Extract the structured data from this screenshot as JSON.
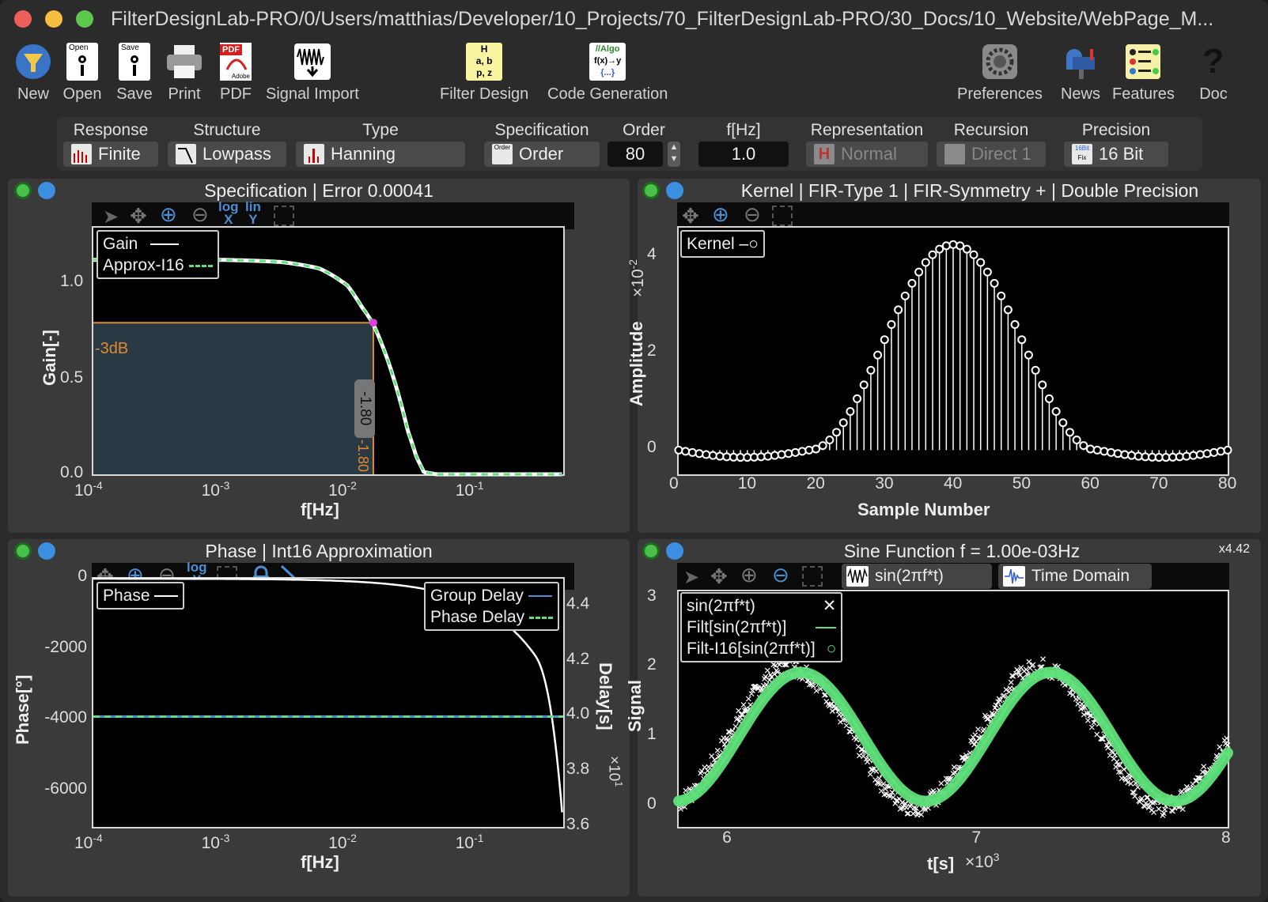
{
  "window": {
    "title": "FilterDesignLab-PRO/0/Users/matthias/Developer/10_Projects/70_FilterDesignLab-PRO/30_Docs/10_Website/WebPage_M..."
  },
  "toolbar": {
    "new": "New",
    "open": "Open",
    "save": "Save",
    "print": "Print",
    "pdf": "PDF",
    "signal_import": "Signal Import",
    "filter_design": "Filter Design",
    "code_generation": "Code Generation",
    "preferences": "Preferences",
    "news": "News",
    "features": "Features",
    "doc": "Doc",
    "icon_text": {
      "open": "Open",
      "save": "Save",
      "pdf": "PDF",
      "adobe": "Adobe",
      "fd1": "H",
      "fd2": "a, b",
      "fd3": "p, z",
      "cg1": "//Algo",
      "cg2": "f(x)→y",
      "cg3": "{...}",
      "doc": "?"
    }
  },
  "options": {
    "response": {
      "header": "Response",
      "value": "Finite"
    },
    "structure": {
      "header": "Structure",
      "value": "Lowpass"
    },
    "type": {
      "header": "Type",
      "value": "Hanning"
    },
    "specification": {
      "header": "Specification",
      "value": "Order",
      "icon": "Order"
    },
    "order": {
      "header": "Order",
      "value": "80"
    },
    "fhz": {
      "header": "f[Hz]",
      "value": "1.0"
    },
    "representation": {
      "header": "Representation",
      "value": "Normal",
      "icon": "H"
    },
    "recursion": {
      "header": "Recursion",
      "value": "Direct 1"
    },
    "precision": {
      "header": "Precision",
      "value": "16 Bit",
      "icon1": "16Bit",
      "icon2": "Fix"
    }
  },
  "panels": {
    "spec": {
      "title": "Specification | Error 0.00041",
      "xlabel": "f[Hz]",
      "ylabel": "Gain[-]",
      "yticks": [
        "1.0",
        "0.5",
        "0.0"
      ],
      "xticks": [
        "10",
        "-4",
        "10",
        "-3",
        "10",
        "-2",
        "10",
        "-1"
      ],
      "legend": [
        "Gain",
        "Approx-I16"
      ],
      "marker_db": "-3dB",
      "marker_val": "-1.80",
      "marker_val2": "-1.80",
      "tool_log": "log",
      "tool_lin": "lin",
      "tool_x": "X",
      "tool_y": "Y"
    },
    "kernel": {
      "title": "Kernel | FIR-Type 1 | FIR-Symmetry + | Double Precision",
      "xlabel": "Sample Number",
      "ylabel": "Amplitude",
      "yscale": "×10",
      "yscale_exp": "-2",
      "yticks": [
        "4",
        "2",
        "0"
      ],
      "xticks": [
        "0",
        "10",
        "20",
        "30",
        "40",
        "50",
        "60",
        "70",
        "80"
      ],
      "legend": "Kernel"
    },
    "phase": {
      "title": "Phase | Int16 Approximation",
      "xlabel": "f[Hz]",
      "ylabel": "Phase[°]",
      "y2label": "Delay[s]",
      "y2scale": "×10",
      "y2scale_exp": "1",
      "yticks": [
        "0",
        "-2000",
        "-4000",
        "-6000"
      ],
      "y2ticks": [
        "4.4",
        "4.2",
        "4.0",
        "3.8",
        "3.6"
      ],
      "xticks": [
        "10",
        "-4",
        "10",
        "-3",
        "10",
        "-2",
        "10",
        "-1"
      ],
      "legend1": "Phase",
      "legend2": [
        "Group Delay",
        "Phase Delay"
      ],
      "tool_log": "log",
      "tool_x": "X"
    },
    "sine": {
      "title": "Sine Function f = 1.00e-03Hz",
      "zoom": "x4.42",
      "xlabel": "t[s]",
      "xscale": "×10",
      "xscale_exp": "3",
      "ylabel": "Signal",
      "yticks": [
        "3",
        "2",
        "1",
        "0"
      ],
      "xticks": [
        "6",
        "7",
        "8"
      ],
      "btn1": "sin(2πf*t)",
      "btn2": "Time Domain",
      "legend": [
        "sin(2πf*t)",
        "Filt[sin(2πf*t)]",
        "Filt-I16[sin(2πf*t)]"
      ]
    }
  },
  "chart_data": [
    {
      "type": "line",
      "title": "Specification | Error 0.00041",
      "xlabel": "f[Hz]",
      "ylabel": "Gain[-]",
      "xscale": "log",
      "xlim": [
        0.0001,
        0.5
      ],
      "ylim": [
        0,
        1.15
      ],
      "series": [
        {
          "name": "Gain",
          "x": [
            0.0001,
            0.001,
            0.003,
            0.006,
            0.01,
            0.013,
            0.016,
            0.02,
            0.025,
            0.03,
            0.035,
            0.04,
            0.05,
            0.1,
            0.5
          ],
          "y": [
            1,
            1,
            0.99,
            0.96,
            0.88,
            0.78,
            0.7,
            0.56,
            0.38,
            0.2,
            0.08,
            0.01,
            0,
            0,
            0
          ]
        },
        {
          "name": "Approx-I16",
          "x": [
            0.0001,
            0.001,
            0.003,
            0.006,
            0.01,
            0.013,
            0.016,
            0.02,
            0.025,
            0.03,
            0.035,
            0.04,
            0.05,
            0.1,
            0.5
          ],
          "y": [
            1,
            1,
            0.99,
            0.96,
            0.88,
            0.78,
            0.7,
            0.56,
            0.38,
            0.2,
            0.08,
            0.01,
            0,
            0,
            0
          ]
        }
      ],
      "marker": {
        "x": 0.016,
        "y": 0.707,
        "label": "-3dB"
      }
    },
    {
      "type": "scatter",
      "title": "Kernel | FIR-Type 1 | FIR-Symmetry + | Double Precision",
      "xlabel": "Sample Number",
      "ylabel": "Amplitude",
      "xlim": [
        0,
        80
      ],
      "ylim": [
        -0.5,
        4.6
      ],
      "yunit": "×10^-2",
      "series": [
        {
          "name": "Kernel",
          "model": "raised-cosine centered at 40, peak 4.25, width 18, sidelobe -0.15 near 13 and 67",
          "x": [
            0,
            5,
            10,
            13,
            18,
            20,
            25,
            30,
            35,
            40,
            45,
            50,
            55,
            60,
            62,
            67,
            70,
            75,
            80
          ],
          "y": [
            0,
            -0.05,
            -0.12,
            -0.15,
            0,
            0.15,
            1.0,
            2.5,
            3.8,
            4.25,
            3.8,
            2.5,
            1.0,
            0.15,
            0,
            -0.15,
            -0.12,
            -0.05,
            0
          ]
        }
      ]
    },
    {
      "type": "line",
      "title": "Phase | Int16 Approximation",
      "xlabel": "f[Hz]",
      "ylabel": "Phase[°]",
      "y2label": "Delay[s]",
      "xscale": "log",
      "xlim": [
        0.0001,
        0.5
      ],
      "ylim": [
        -7000,
        0
      ],
      "y2lim": [
        3.6,
        4.5
      ],
      "series": [
        {
          "name": "Phase",
          "x": [
            0.0001,
            0.001,
            0.01,
            0.05,
            0.1,
            0.2,
            0.3,
            0.4,
            0.5
          ],
          "y": [
            0,
            -7,
            -72,
            -360,
            -720,
            -1440,
            -2160,
            -2880,
            -7000
          ]
        },
        {
          "name": "Group Delay",
          "x": [
            0.0001,
            0.5
          ],
          "y": [
            4.0,
            4.0
          ]
        },
        {
          "name": "Phase Delay",
          "x": [
            0.0001,
            0.5
          ],
          "y": [
            4.0,
            4.0
          ]
        }
      ]
    },
    {
      "type": "line",
      "title": "Sine Function f = 1.00e-03Hz",
      "xlabel": "t[s]",
      "ylabel": "Signal",
      "xlim": [
        5800,
        8000
      ],
      "ylim": [
        -0.3,
        3.1
      ],
      "series": [
        {
          "name": "sin(2πf*t)",
          "model": "noisy sine, amplitude ~1.1, offset 1"
        },
        {
          "name": "Filt[sin(2πf*t)]",
          "model": "1+sin(2π·0.001·(t-40))"
        },
        {
          "name": "Filt-I16[sin(2πf*t)]",
          "model": "1+sin(2π·0.001·(t-40))"
        }
      ]
    }
  ],
  "colors": {
    "accent_green": "#5fe07a",
    "plot_blue": "#4a8fd6",
    "orange": "#e08a2e",
    "magenta": "#e040e0",
    "pass_fill": "#2a3a45"
  }
}
